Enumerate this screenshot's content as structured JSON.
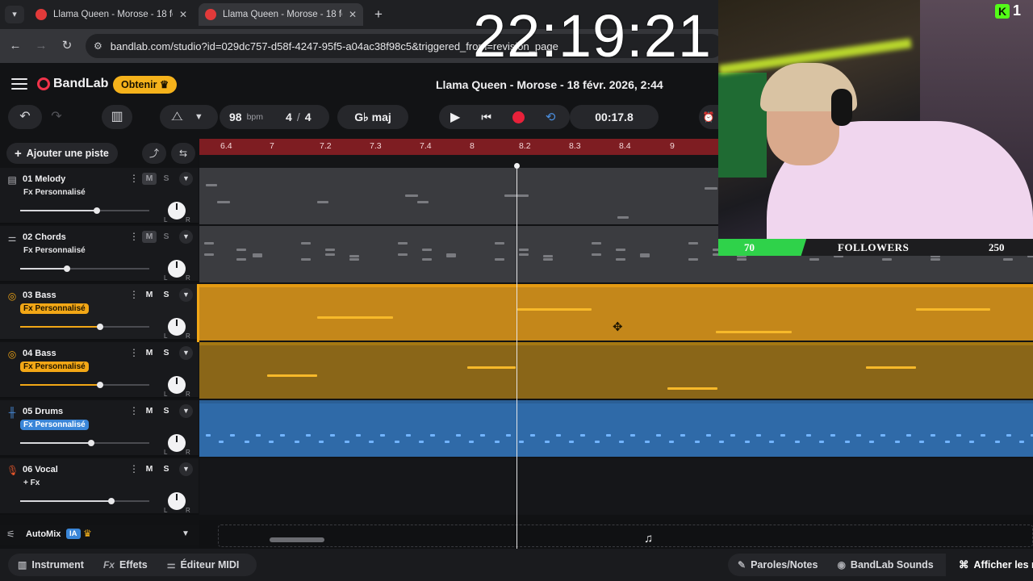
{
  "browser": {
    "tabs": [
      {
        "title": "Llama Queen - Morose - 18 févr.",
        "active": false
      },
      {
        "title": "Llama Queen - Morose - 18 févr.",
        "active": true
      }
    ],
    "url": "bandlab.com/studio?id=029dc757-d58f-4247-95f5-a04ac38f98c5&triggered_from=revision_page"
  },
  "overlay": {
    "clock": "22:19:21",
    "kick_badge": "K",
    "kick_count": "1",
    "followers": {
      "current": "70",
      "label": "FOLLOWERS",
      "goal": "250",
      "progress": 0.28
    }
  },
  "app": {
    "logo": "BandLab",
    "upgrade_label": "Obtenir",
    "song_title": "Llama Queen - Morose - 18 févr. 2026, 2:44"
  },
  "toolbar": {
    "bpm": "98",
    "bpm_unit": "bpm",
    "sig_top": "4",
    "sig_sep": "/",
    "sig_bottom": "4",
    "key": "G♭ maj",
    "time": "00:17.8"
  },
  "left": {
    "add_track_label": "Ajouter une piste",
    "automix_label": "AutoMix",
    "ai_badge": "IA"
  },
  "tracks": [
    {
      "name": "01  Melody",
      "fx": "Fx Personnalisé",
      "fx_style": "plain",
      "m": "M",
      "s": "S",
      "volume": 0.6
    },
    {
      "name": "02  Chords",
      "fx": "Fx Personnalisé",
      "fx_style": "plain",
      "m": "M",
      "s": "S",
      "volume": 0.36
    },
    {
      "name": "03  Bass",
      "fx": "Fx Personnalisé",
      "fx_style": "orange",
      "m": "M",
      "s": "S",
      "volume": 0.62
    },
    {
      "name": "04  Bass",
      "fx": "Fx Personnalisé",
      "fx_style": "orange",
      "m": "M",
      "s": "S",
      "volume": 0.62
    },
    {
      "name": "05  Drums",
      "fx": "Fx Personnalisé",
      "fx_style": "blue",
      "m": "M",
      "s": "S",
      "volume": 0.55
    },
    {
      "name": "06  Vocal",
      "fx": "+ Fx",
      "fx_style": "plain",
      "m": "M",
      "s": "S",
      "volume": 0.7
    }
  ],
  "pan_labels": {
    "left": "L",
    "right": "R"
  },
  "ruler": [
    "6.4",
    "7",
    "7.2",
    "7.3",
    "7.4",
    "8",
    "8.2",
    "8.3",
    "8.4",
    "9"
  ],
  "bottom": {
    "instrument": "Instrument",
    "effects": "Effets",
    "effects_prefix": "Fx",
    "midi_editor": "Éditeur MIDI",
    "lyrics": "Paroles/Notes",
    "sounds": "BandLab Sounds",
    "show_more": "Afficher les r"
  },
  "colors": {
    "accent": "#f2a716",
    "record": "#e8213a",
    "drums": "#2f6aa8",
    "followers_bar": "#2fd24a"
  }
}
